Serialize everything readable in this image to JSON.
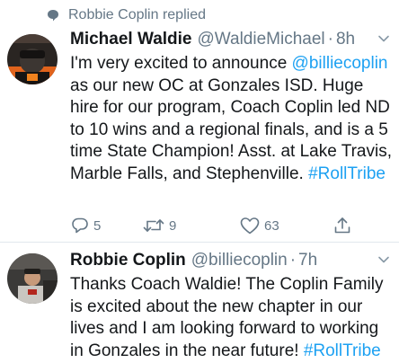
{
  "context": {
    "label": "Robbie Coplin replied",
    "icon": "speech-bubble-icon"
  },
  "tweets": [
    {
      "name": "Michael Waldie",
      "handle": "@WaldieMichael",
      "separator": "·",
      "time": "8h",
      "text_parts": {
        "p1": "I'm very excited to announce ",
        "mention": "@billiecoplin",
        "p2": " as our new OC at Gonzales ISD. Huge hire for our program, Coach Coplin led ND to 10 wins and a regional finals, and is a 5 time State Champion! Asst. at Lake Travis, Marble Falls, and Stephenville. ",
        "hashtag": "#RollTribe"
      },
      "counts": {
        "replies": "5",
        "retweets": "9",
        "likes": "63"
      }
    },
    {
      "name": "Robbie Coplin",
      "handle": "@billiecoplin",
      "separator": "·",
      "time": "7h",
      "text_parts": {
        "p1": "Thanks Coach Waldie! The Coplin Family is excited about the new chapter in our lives and I am looking forward to working in Gonzales in the near future! ",
        "hashtag": "#RollTribe"
      }
    }
  ],
  "colors": {
    "link": "#1da1f2",
    "muted": "#657786",
    "text": "#14171a"
  }
}
